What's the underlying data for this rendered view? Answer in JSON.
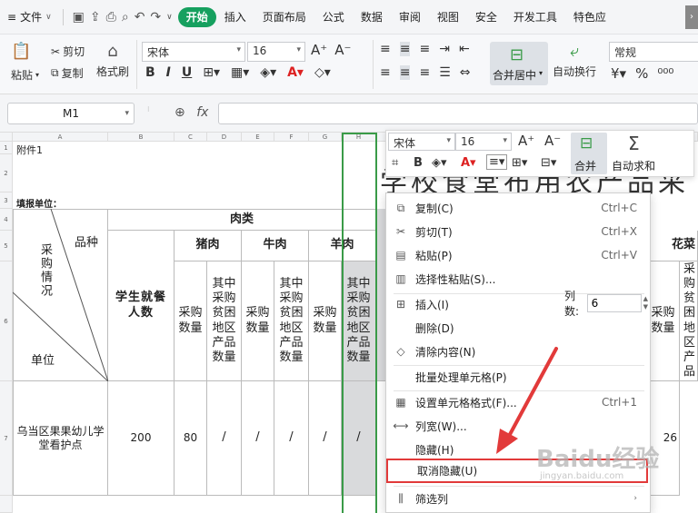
{
  "menubar": {
    "file_label": "文件",
    "tabs": [
      {
        "label": "开始",
        "active": true
      },
      {
        "label": "插入"
      },
      {
        "label": "页面布局"
      },
      {
        "label": "公式"
      },
      {
        "label": "数据"
      },
      {
        "label": "审阅"
      },
      {
        "label": "视图"
      },
      {
        "label": "安全"
      },
      {
        "label": "开发工具"
      },
      {
        "label": "特色应"
      }
    ],
    "accent_color": "#16a05f"
  },
  "ribbon": {
    "paste": "粘贴",
    "cut": "剪切",
    "copy": "复制",
    "format_painter": "格式刷",
    "font_name": "宋体",
    "font_size": "16",
    "merge_center": "合并居中",
    "wrap_text": "自动换行",
    "number_format": "常规"
  },
  "formula_bar": {
    "name_box": "M1",
    "fx": "fx"
  },
  "sheet": {
    "columns": [
      "A",
      "B",
      "C",
      "D",
      "E",
      "F",
      "G",
      "H"
    ],
    "rows": [
      "1",
      "2",
      "3",
      "4",
      "5",
      "6",
      "7"
    ],
    "a1": "附件1",
    "fill_unit": "填报单位：",
    "title": "学校食堂布用农产品采",
    "meat": "肉类",
    "variety": "品种",
    "procurement": "采购情况",
    "unit": "单位",
    "students": "学生就餐人数",
    "pork": "猪肉",
    "beef": "牛肉",
    "mutton": "羊肉",
    "vegetables": "花菜",
    "qty": "采购数量",
    "poor_qty": "其中采购贫困地区产品数量",
    "school": "乌当区果果幼儿学堂看护点",
    "students_val": "200",
    "pork_qty": "80",
    "slash": "/",
    "right_val": "26"
  },
  "float_toolbar": {
    "font_name": "宋体",
    "font_size": "16",
    "merge": "合并",
    "autosum": "自动求和"
  },
  "context_menu": {
    "items": [
      {
        "label": "复制(C)",
        "shortcut": "Ctrl+C",
        "icon": "copy-icon"
      },
      {
        "label": "剪切(T)",
        "shortcut": "Ctrl+X",
        "icon": "scissors-icon"
      },
      {
        "label": "粘贴(P)",
        "shortcut": "Ctrl+V",
        "icon": "paste-icon"
      },
      {
        "label": "选择性粘贴(S)...",
        "shortcut": "",
        "icon": "paste-special-icon"
      },
      {
        "label": "插入(I)",
        "shortcut": "",
        "icon": "insert-icon"
      },
      {
        "label": "删除(D)",
        "shortcut": "",
        "icon": ""
      },
      {
        "label": "清除内容(N)",
        "shortcut": "",
        "icon": "eraser-icon"
      },
      {
        "label": "批量处理单元格(P)",
        "shortcut": "",
        "icon": ""
      },
      {
        "label": "设置单元格格式(F)...",
        "shortcut": "Ctrl+1",
        "icon": "format-cells-icon"
      },
      {
        "label": "列宽(W)...",
        "shortcut": "",
        "icon": "column-width-icon"
      },
      {
        "label": "隐藏(H)",
        "shortcut": "",
        "icon": ""
      },
      {
        "label": "取消隐藏(U)",
        "shortcut": "",
        "icon": "",
        "highlighted": true
      },
      {
        "label": "筛选列",
        "shortcut": "",
        "icon": "filter-column-icon"
      }
    ],
    "columns_label": "列数:",
    "columns_value": "6",
    "highlight_color": "#e23a3a"
  },
  "watermark": {
    "text": "Baidu经验",
    "sub": "jingyan.baidu.com"
  }
}
